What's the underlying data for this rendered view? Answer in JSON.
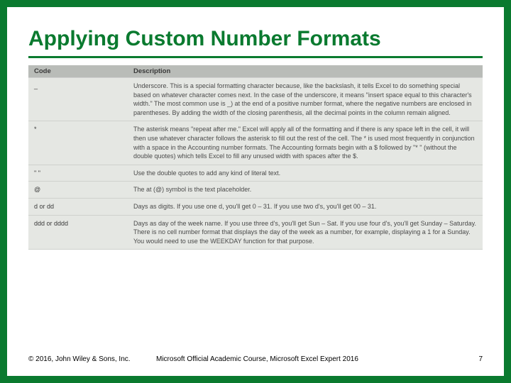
{
  "title": "Applying Custom Number Formats",
  "table": {
    "headers": {
      "code": "Code",
      "description": "Description"
    },
    "rows": [
      {
        "code": "_",
        "desc": "Underscore. This is a special formatting character because, like the backslash, it tells Excel to do something special based on whatever character comes next. In the case of the underscore, it means \"insert space equal to this character's width.\" The most common use is _) at the end of a positive number format, where the negative numbers are enclosed in parentheses. By adding the width of the closing parenthesis, all the decimal points in the column remain aligned."
      },
      {
        "code": "*",
        "desc": "The asterisk means \"repeat after me.\" Excel will apply all of the formatting and if there is any space left in the cell, it will then use whatever character follows the asterisk to fill out the rest of the cell. The * is used most frequently in conjunction with a space in the Accounting number formats. The Accounting formats begin with a $ followed by \"* \" (without the double quotes) which tells Excel to fill any unused width with spaces after the $."
      },
      {
        "code": "\" \"",
        "desc": "Use the double quotes to add any kind of literal text."
      },
      {
        "code": "@",
        "desc": "The at (@) symbol is the text placeholder."
      },
      {
        "code": "d or dd",
        "desc": "Days as digits. If you use one d, you'll get 0 – 31. If you use two d's, you'll get 00 – 31."
      },
      {
        "code": "ddd or dddd",
        "desc": "Days as day of the week name. If you use three d's, you'll get Sun – Sat. If you use four d's, you'll get Sunday – Saturday. There is no cell number format that displays the day of the week as a number, for example, displaying a 1 for a Sunday. You would need to use the WEEKDAY function for that purpose."
      }
    ]
  },
  "footer": {
    "copyright": "© 2016, John Wiley & Sons, Inc.",
    "course": "Microsoft Official Academic Course, Microsoft Excel Expert 2016",
    "page": "7"
  }
}
